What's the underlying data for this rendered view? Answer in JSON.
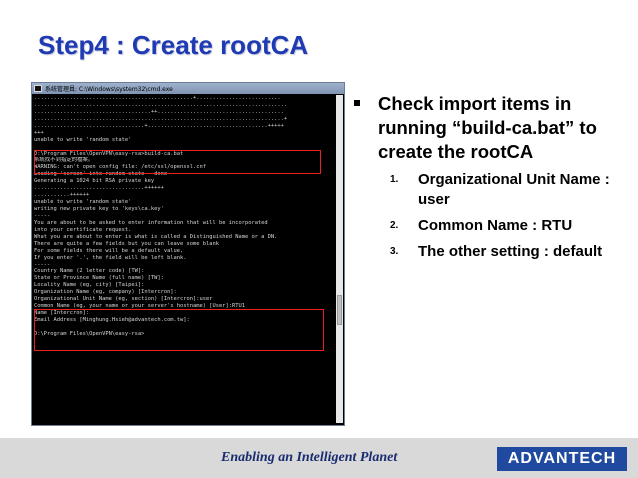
{
  "slide": {
    "title": "Step4 : Create rootCA",
    "main_bullet": "Check import items in running “build-ca.bat” to create the rootCA",
    "sub_items": [
      {
        "num": "1.",
        "text": "Organizational Unit Name : user"
      },
      {
        "num": "2.",
        "text": "Common Name : RTU"
      },
      {
        "num": "3.",
        "text": "The other setting : default"
      }
    ]
  },
  "cmd_window": {
    "title": "系统管理員: C:\\Windows\\system32\\cmd.exe",
    "lines": [
      ".................................................+..........................",
      "..............................................................................",
      "....................................++.......................................",
      ".............................................................................+",
      "..................................+.....................................+++++",
      "+++",
      "unable to write 'random state'",
      "",
      "D:\\Program Files\\OpenVPN\\easy-rsa>build-ca.bat",
      "系統找不到指定的檔案。",
      "WARNING: can't open config file: /etc/ssl/openssl.cnf",
      "Loading 'screen' into random state - done",
      "Generating a 1024 bit RSA private key",
      "..................................++++++",
      "...........++++++",
      "unable to write 'random state'",
      "writing new private key to 'keys\\ca.key'",
      "-----",
      "You are about to be asked to enter information that will be incorporated",
      "into your certificate request.",
      "What you are about to enter is what is called a Distinguished Name or a DN.",
      "There are quite a few fields but you can leave some blank",
      "For some fields there will be a default value,",
      "If you enter '.', the field will be left blank.",
      "-----",
      "Country Name (2 letter code) [TW]:",
      "State or Province Name (full name) [TW]:",
      "Locality Name (eg, city) [Taipei]:",
      "Organization Name (eg, company) [Intercron]:",
      "Organizational Unit Name (eg, section) [Intercron]:user",
      "Common Name (eg, your name or your server's hostname) [User]:RTU1",
      "Name [Intercron]:",
      "Email Address [Minghung.Hsieh@advantech.com.tw]:",
      "",
      "D:\\Program Files\\OpenVPN\\easy-rsa>"
    ]
  },
  "footer": {
    "tagline": "Enabling an Intelligent Planet",
    "logo": "ADVANTECH"
  }
}
